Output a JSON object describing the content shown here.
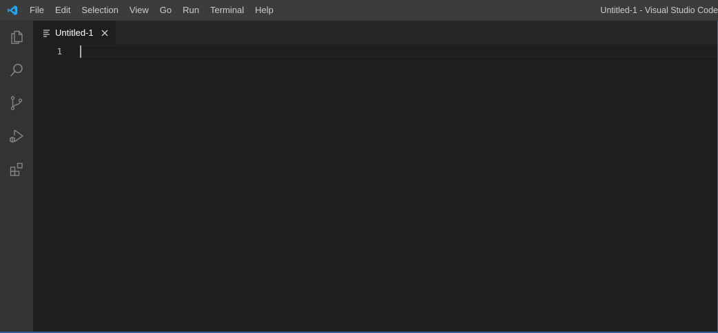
{
  "app": {
    "logo_icon": "vscode-logo-icon",
    "window_title": "Untitled-1 - Visual Studio Code"
  },
  "menubar": {
    "items": [
      "File",
      "Edit",
      "Selection",
      "View",
      "Go",
      "Run",
      "Terminal",
      "Help"
    ]
  },
  "activitybar": {
    "items": [
      {
        "name": "explorer",
        "icon": "files-icon"
      },
      {
        "name": "search",
        "icon": "search-icon"
      },
      {
        "name": "source-control",
        "icon": "source-control-icon"
      },
      {
        "name": "run-and-debug",
        "icon": "run-debug-icon"
      },
      {
        "name": "extensions",
        "icon": "extensions-icon"
      }
    ]
  },
  "editor": {
    "tabs": [
      {
        "label": "Untitled-1",
        "icon": "file-lines-icon",
        "active": true
      }
    ],
    "line_numbers": [
      "1"
    ]
  },
  "colors": {
    "titlebar": "#3c3c3c",
    "activitybar": "#333333",
    "editor_bg": "#1e1e1e",
    "tabs_bg": "#252526",
    "logo_blue": "#23a9f2"
  }
}
